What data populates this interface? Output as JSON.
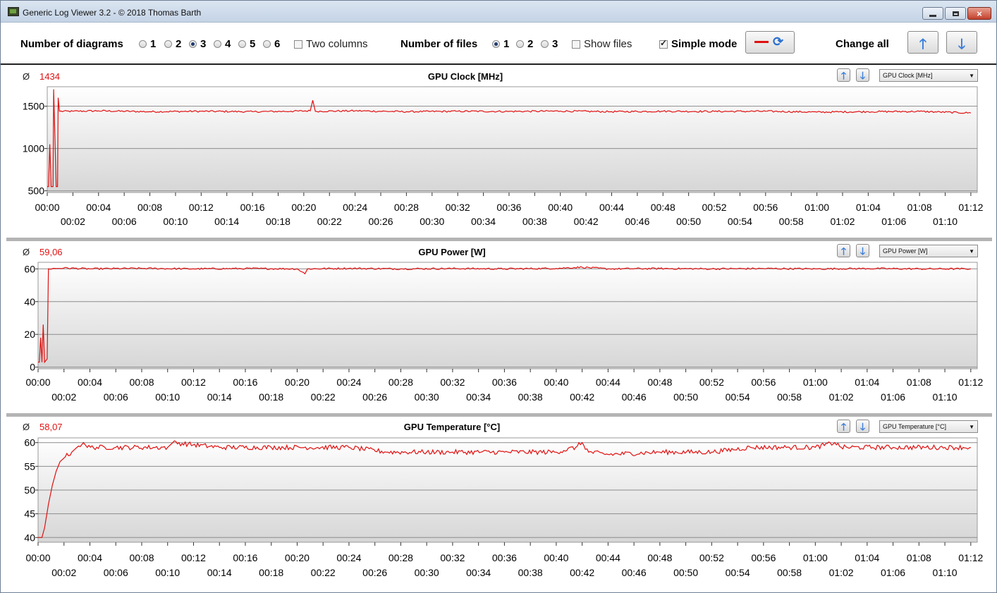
{
  "window": {
    "title": "Generic Log Viewer 3.2 - © 2018 Thomas Barth",
    "icon": "app-icon",
    "buttons": {
      "minimize": "minimize-icon",
      "maximize": "maximize-icon",
      "close": "×"
    }
  },
  "toolbar": {
    "diagrams_label": "Number of diagrams",
    "diagram_options": [
      "1",
      "2",
      "3",
      "4",
      "5",
      "6"
    ],
    "diagrams_selected": "3",
    "two_columns_label": "Two columns",
    "two_columns_checked": false,
    "files_label": "Number of files",
    "file_options": [
      "1",
      "2",
      "3"
    ],
    "files_selected": "1",
    "show_files_label": "Show files",
    "show_files_checked": false,
    "simple_mode_label": "Simple mode",
    "simple_mode_checked": true,
    "change_all_label": "Change all",
    "line_color": "#e01010"
  },
  "charts": [
    {
      "avg_symbol": "Ø",
      "avg_value": "1434",
      "title": "GPU Clock [MHz]",
      "dropdown": "GPU Clock [MHz]",
      "chart_data": {
        "type": "line",
        "title": "GPU Clock [MHz]",
        "ylim": [
          480,
          1730
        ],
        "yticks": [
          "500",
          "1000",
          "1500"
        ],
        "ytick_values": [
          500,
          1000,
          1500
        ],
        "grid": true,
        "xlim": [
          0,
          72.5
        ],
        "xticks_top": [
          "00:00",
          "00:04",
          "00:08",
          "00:12",
          "00:16",
          "00:20",
          "00:24",
          "00:28",
          "00:32",
          "00:36",
          "00:40",
          "00:44",
          "00:48",
          "00:52",
          "00:56",
          "01:00",
          "01:04",
          "01:08",
          "01:12"
        ],
        "xticks_bottom": [
          "00:02",
          "00:06",
          "00:10",
          "00:14",
          "00:18",
          "00:22",
          "00:26",
          "00:30",
          "00:34",
          "00:38",
          "00:42",
          "00:46",
          "00:50",
          "00:54",
          "00:58",
          "01:02",
          "01:06",
          "01:10"
        ],
        "series": [
          {
            "color": "#e01010",
            "points": [
              [
                0,
                550
              ],
              [
                0.1,
                550
              ],
              [
                0.2,
                1050
              ],
              [
                0.3,
                550
              ],
              [
                0.45,
                550
              ],
              [
                0.5,
                1700
              ],
              [
                0.7,
                550
              ],
              [
                0.8,
                550
              ],
              [
                0.85,
                1600
              ],
              [
                0.95,
                1440
              ],
              [
                2,
                1440
              ],
              [
                4,
                1445
              ],
              [
                8,
                1435
              ],
              [
                12,
                1440
              ],
              [
                16,
                1435
              ],
              [
                19,
                1440
              ],
              [
                20.5,
                1445
              ],
              [
                20.7,
                1570
              ],
              [
                20.9,
                1440
              ],
              [
                24,
                1445
              ],
              [
                28,
                1435
              ],
              [
                32,
                1440
              ],
              [
                36,
                1438
              ],
              [
                40,
                1442
              ],
              [
                44,
                1435
              ],
              [
                48,
                1440
              ],
              [
                52,
                1438
              ],
              [
                56,
                1440
              ],
              [
                60,
                1430
              ],
              [
                64,
                1435
              ],
              [
                68,
                1438
              ],
              [
                72,
                1420
              ]
            ],
            "noise": 10
          }
        ]
      }
    },
    {
      "avg_symbol": "Ø",
      "avg_value": "59,06",
      "title": "GPU Power [W]",
      "dropdown": "GPU Power [W]",
      "chart_data": {
        "type": "line",
        "title": "GPU Power [W]",
        "ylim": [
          -1,
          64
        ],
        "yticks": [
          "0",
          "20",
          "40",
          "60"
        ],
        "ytick_values": [
          0,
          20,
          40,
          60
        ],
        "grid": true,
        "xlim": [
          0,
          72.5
        ],
        "xticks_top": [
          "00:00",
          "00:04",
          "00:08",
          "00:12",
          "00:16",
          "00:20",
          "00:24",
          "00:28",
          "00:32",
          "00:36",
          "00:40",
          "00:44",
          "00:48",
          "00:52",
          "00:56",
          "01:00",
          "01:04",
          "01:08",
          "01:12"
        ],
        "xticks_bottom": [
          "00:02",
          "00:06",
          "00:10",
          "00:14",
          "00:18",
          "00:22",
          "00:26",
          "00:30",
          "00:34",
          "00:38",
          "00:42",
          "00:46",
          "00:50",
          "00:54",
          "00:58",
          "01:02",
          "01:06",
          "01:10"
        ],
        "series": [
          {
            "color": "#e01010",
            "points": [
              [
                0,
                3
              ],
              [
                0.1,
                3
              ],
              [
                0.2,
                18
              ],
              [
                0.3,
                3
              ],
              [
                0.4,
                26
              ],
              [
                0.5,
                3
              ],
              [
                0.7,
                5
              ],
              [
                0.8,
                60
              ],
              [
                2,
                60.5
              ],
              [
                4,
                60
              ],
              [
                8,
                60.3
              ],
              [
                12,
                60
              ],
              [
                16,
                60.2
              ],
              [
                20,
                60
              ],
              [
                20.6,
                57
              ],
              [
                20.8,
                60
              ],
              [
                24,
                60.3
              ],
              [
                28,
                60
              ],
              [
                32,
                60.2
              ],
              [
                36,
                60
              ],
              [
                40,
                60.3
              ],
              [
                42,
                61
              ],
              [
                44,
                60
              ],
              [
                48,
                60.2
              ],
              [
                52,
                60
              ],
              [
                56,
                60.2
              ],
              [
                60,
                60
              ],
              [
                64,
                60.2
              ],
              [
                68,
                60
              ],
              [
                72,
                60
              ]
            ],
            "noise": 0.5
          }
        ]
      }
    },
    {
      "avg_symbol": "Ø",
      "avg_value": "58,07",
      "title": "GPU Temperature [°C]",
      "dropdown": "GPU Temperature [°C]",
      "chart_data": {
        "type": "line",
        "title": "GPU Temperature [°C]",
        "ylim": [
          39,
          61
        ],
        "yticks": [
          "40",
          "45",
          "50",
          "55",
          "60"
        ],
        "ytick_values": [
          40,
          45,
          50,
          55,
          60
        ],
        "grid": true,
        "xlim": [
          0,
          72.5
        ],
        "xticks_top": [
          "00:00",
          "00:04",
          "00:08",
          "00:12",
          "00:16",
          "00:20",
          "00:24",
          "00:28",
          "00:32",
          "00:36",
          "00:40",
          "00:44",
          "00:48",
          "00:52",
          "00:56",
          "01:00",
          "01:04",
          "01:08",
          "01:12"
        ],
        "xticks_bottom": [
          "00:02",
          "00:06",
          "00:10",
          "00:14",
          "00:18",
          "00:22",
          "00:26",
          "00:30",
          "00:34",
          "00:38",
          "00:42",
          "00:46",
          "00:50",
          "00:54",
          "00:58",
          "01:02",
          "01:06",
          "01:10"
        ],
        "series": [
          {
            "color": "#e01010",
            "points": [
              [
                0,
                40
              ],
              [
                0.3,
                40
              ],
              [
                0.5,
                42
              ],
              [
                0.8,
                47
              ],
              [
                1.1,
                51
              ],
              [
                1.4,
                54
              ],
              [
                1.7,
                56
              ],
              [
                2.1,
                57
              ],
              [
                2.6,
                58
              ],
              [
                3,
                59
              ],
              [
                3.5,
                60
              ],
              [
                3.8,
                59
              ],
              [
                6,
                59
              ],
              [
                10,
                59
              ],
              [
                10.4,
                60
              ],
              [
                14,
                59
              ],
              [
                18,
                59
              ],
              [
                24,
                59
              ],
              [
                27,
                58
              ],
              [
                30,
                58
              ],
              [
                32,
                58
              ],
              [
                36,
                58
              ],
              [
                40,
                58
              ],
              [
                41.5,
                59
              ],
              [
                42,
                60
              ],
              [
                42.5,
                58
              ],
              [
                44,
                57.5
              ],
              [
                48,
                58
              ],
              [
                52,
                58
              ],
              [
                55,
                59
              ],
              [
                58,
                59
              ],
              [
                60,
                59
              ],
              [
                61.5,
                60
              ],
              [
                62,
                59
              ],
              [
                66,
                59
              ],
              [
                70,
                59
              ],
              [
                72,
                59
              ]
            ],
            "noise": 0.5
          }
        ]
      }
    }
  ]
}
